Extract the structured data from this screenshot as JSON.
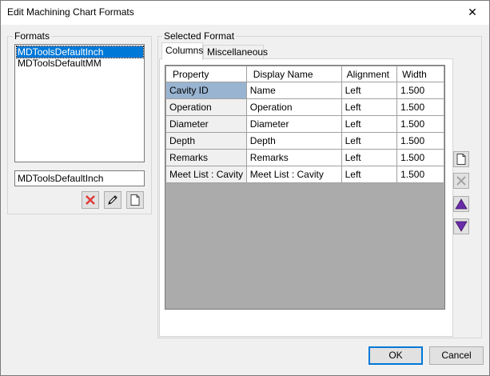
{
  "window": {
    "title": "Edit Machining Chart Formats",
    "close_glyph": "✕"
  },
  "formats": {
    "label": "Formats",
    "items": [
      "MDToolsDefaultInch",
      "MDToolsDefaultMM"
    ],
    "selected_index": 0,
    "name_value": "MDToolsDefaultInch"
  },
  "selected_format": {
    "label": "Selected Format",
    "tabs": [
      "Columns",
      "Miscellaneous"
    ],
    "active_tab": 0,
    "columns": {
      "headers": [
        "Property",
        "Display Name",
        "Alignment",
        "Width"
      ],
      "rows": [
        [
          "Cavity ID",
          "Name",
          "Left",
          "1.500"
        ],
        [
          "Operation",
          "Operation",
          "Left",
          "1.500"
        ],
        [
          "Diameter",
          "Diameter",
          "Left",
          "1.500"
        ],
        [
          "Depth",
          "Depth",
          "Left",
          "1.500"
        ],
        [
          "Remarks",
          "Remarks",
          "Left",
          "1.500"
        ],
        [
          "Meet List : Cavity",
          "Meet List : Cavity",
          "Left",
          "1.500"
        ]
      ]
    }
  },
  "buttons": {
    "ok": "OK",
    "cancel": "Cancel"
  },
  "colors": {
    "selection": "#0078d7",
    "cell_selection": "#99b4d1",
    "delete_icon": "#cc0000",
    "arrow_icon": "#6a2ca8"
  }
}
